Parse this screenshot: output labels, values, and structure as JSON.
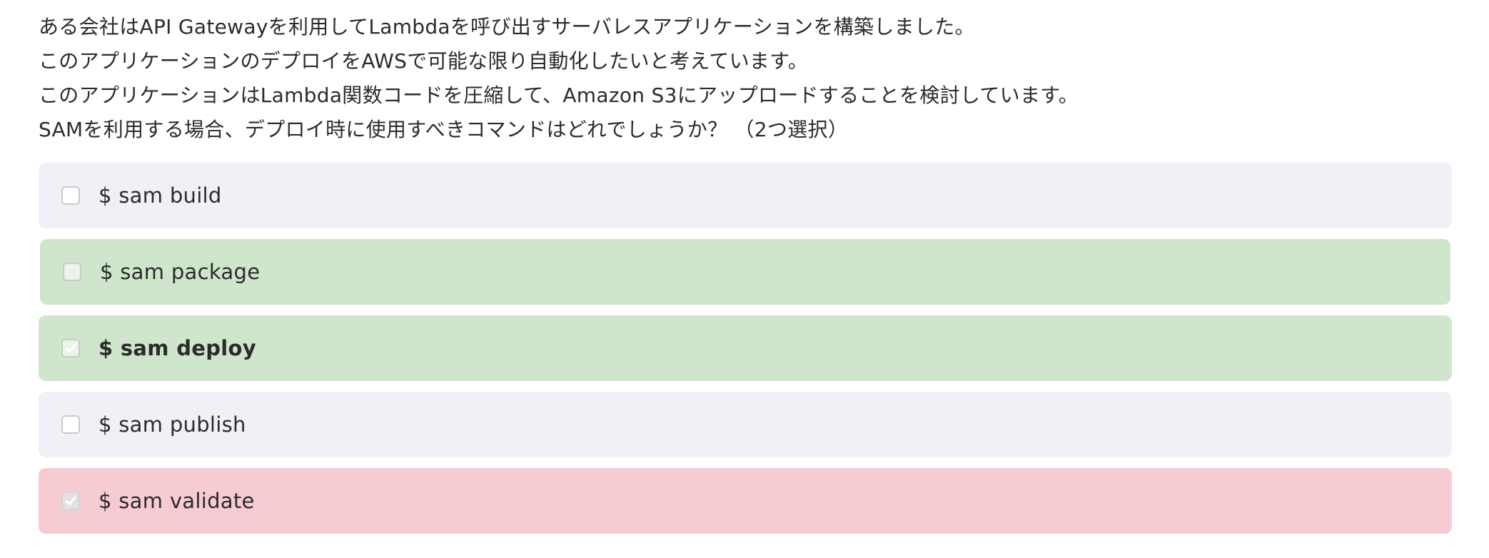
{
  "question": {
    "lines": [
      "ある会社はAPI Gatewayを利用してLambdaを呼び出すサーバレスアプリケーションを構築しました。",
      "このアプリケーションのデプロイをAWSで可能な限り自動化したいと考えています。",
      "このアプリケーションはLambda関数コードを圧縮して、Amazon S3にアップロードすることを検討しています。",
      "SAMを利用する場合、デプロイ時に使用すべきコマンドはどれでしょうか？ （2つ選択）"
    ]
  },
  "options": [
    {
      "label": "$ sam build",
      "checked": false,
      "status": "neutral"
    },
    {
      "label": "$ sam package",
      "checked": false,
      "status": "correct"
    },
    {
      "label": "$ sam deploy",
      "checked": true,
      "status": "correct"
    },
    {
      "label": "$ sam publish",
      "checked": false,
      "status": "neutral"
    },
    {
      "label": "$ sam validate",
      "checked": true,
      "status": "incorrect"
    }
  ],
  "colors": {
    "neutral": "#f0f1f6",
    "correct": "#cfe5cc",
    "incorrect": "#f6ccd2"
  },
  "icons": {
    "checkbox_checked": "check-icon"
  }
}
